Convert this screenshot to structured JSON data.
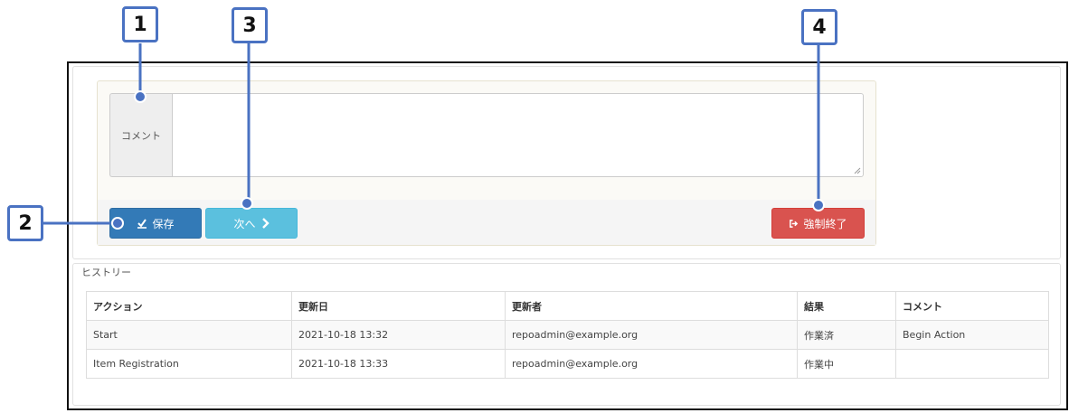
{
  "callouts": [
    "1",
    "2",
    "3",
    "4"
  ],
  "comment_section": {
    "label": "コメント",
    "value": ""
  },
  "buttons": {
    "save": "保存",
    "next": "次へ",
    "force_end": "強制終了"
  },
  "history": {
    "title": "ヒストリー",
    "columns": [
      "アクション",
      "更新日",
      "更新者",
      "結果",
      "コメント"
    ],
    "rows": [
      [
        "Start",
        "2021-10-18 13:32",
        "repoadmin@example.org",
        "作業済",
        "Begin Action"
      ],
      [
        "Item Registration",
        "2021-10-18 13:33",
        "repoadmin@example.org",
        "作業中",
        ""
      ]
    ]
  },
  "colors": {
    "callout_border": "#4a72c2",
    "primary": "#337ab7",
    "info": "#5bc0de",
    "danger": "#d9534f"
  },
  "icons": {
    "save": "check-icon",
    "next": "chevron-right-icon",
    "force_end": "sign-out-icon"
  }
}
